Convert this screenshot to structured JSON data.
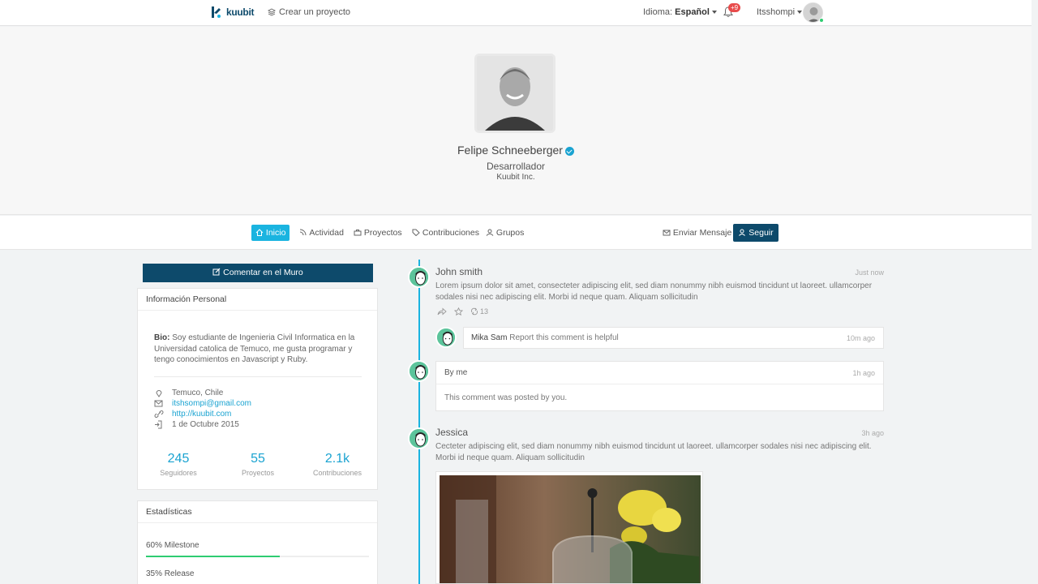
{
  "topbar": {
    "brand": "kuubit",
    "create_project": "Crear un proyecto",
    "language_label": "Idioma:",
    "language_value": "Español",
    "notifications_badge": "+9",
    "username": "Itsshompi"
  },
  "profile": {
    "name": "Felipe Schneeberger",
    "role": "Desarrollador",
    "company": "Kuubit Inc."
  },
  "profile_nav": {
    "tabs": [
      {
        "label": "Inicio",
        "active": true
      },
      {
        "label": "Actividad",
        "active": false
      },
      {
        "label": "Proyectos",
        "active": false
      },
      {
        "label": "Contribuciones",
        "active": false
      },
      {
        "label": "Grupos",
        "active": false
      }
    ],
    "send_message": "Enviar Mensaje",
    "follow": "Seguir"
  },
  "sidebar": {
    "wall_button": "Comentar en el Muro",
    "personal_info": {
      "title": "Información Personal",
      "bio_label": "Bio:",
      "bio_text": "Soy estudiante de Ingenieria Civil Informatica en la Universidad catolica de Temuco, me gusta programar y tengo conocimientos en Javascript y Ruby.",
      "location": "Temuco, Chile",
      "email": "itshsompi@gmail.com",
      "website": "http://kuubit.com",
      "joined": "1 de Octubre 2015",
      "stats": [
        {
          "value": "245",
          "label": "Seguidores"
        },
        {
          "value": "55",
          "label": "Proyectos"
        },
        {
          "value": "2.1k",
          "label": "Contribuciones"
        }
      ]
    },
    "statistics": {
      "title": "Estadísticas",
      "milestones": [
        {
          "label": "60% Milestone",
          "progress": 0.6
        },
        {
          "label": "35% Release",
          "progress": 0.35
        }
      ]
    }
  },
  "timeline": {
    "posts": [
      {
        "author": "John smith",
        "time": "Just now",
        "text": "Lorem ipsum dolor sit amet, consecteter adipiscing elit, sed diam nonummy nibh euismod tincidunt ut laoreet. ullamcorper sodales nisi nec adipiscing elit. Morbi id neque quam. Aliquam sollicitudin",
        "retweet_count": "13",
        "reply": {
          "author": "Mika Sam",
          "text": "Report this comment is helpful",
          "time": "10m ago"
        }
      },
      {
        "author": "By me",
        "time": "1h ago",
        "text": "This comment was posted by you."
      },
      {
        "author": "Jessica",
        "time": "3h ago",
        "text": "Cecteter adipiscing elit, sed diam nonummy nibh euismod tincidunt ut laoreet. ullamcorper sodales nisi nec adipiscing elit. Morbi id neque quam. Aliquam sollicitudin"
      }
    ]
  },
  "colors": {
    "primary_dark": "#0d4a6b",
    "accent": "#1ab4e0",
    "link": "#1aa3d1",
    "success": "#2ecc71",
    "badge": "#e84b4b"
  }
}
